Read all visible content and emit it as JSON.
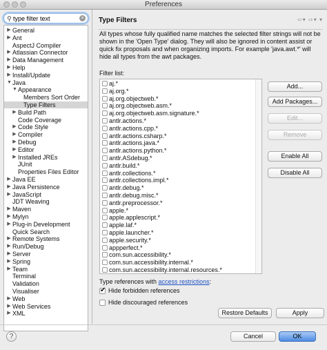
{
  "window": {
    "title": "Preferences"
  },
  "search": {
    "value": "type filter text"
  },
  "tree": [
    {
      "label": "General",
      "arrow": "▶",
      "level": 0
    },
    {
      "label": "Ant",
      "arrow": "▶",
      "level": 0
    },
    {
      "label": "AspectJ Compiler",
      "arrow": "",
      "level": 0
    },
    {
      "label": "Atlassian Connector",
      "arrow": "▶",
      "level": 0
    },
    {
      "label": "Data Management",
      "arrow": "▶",
      "level": 0
    },
    {
      "label": "Help",
      "arrow": "▶",
      "level": 0
    },
    {
      "label": "Install/Update",
      "arrow": "▶",
      "level": 0
    },
    {
      "label": "Java",
      "arrow": "▼",
      "level": 0
    },
    {
      "label": "Appearance",
      "arrow": "▼",
      "level": 1
    },
    {
      "label": "Members Sort Order",
      "arrow": "",
      "level": 2
    },
    {
      "label": "Type Filters",
      "arrow": "",
      "level": 2,
      "selected": true
    },
    {
      "label": "Build Path",
      "arrow": "▶",
      "level": 1
    },
    {
      "label": "Code Coverage",
      "arrow": "",
      "level": 1
    },
    {
      "label": "Code Style",
      "arrow": "▶",
      "level": 1
    },
    {
      "label": "Compiler",
      "arrow": "▶",
      "level": 1
    },
    {
      "label": "Debug",
      "arrow": "▶",
      "level": 1
    },
    {
      "label": "Editor",
      "arrow": "▶",
      "level": 1
    },
    {
      "label": "Installed JREs",
      "arrow": "▶",
      "level": 1
    },
    {
      "label": "JUnit",
      "arrow": "",
      "level": 1
    },
    {
      "label": "Properties Files Editor",
      "arrow": "",
      "level": 1
    },
    {
      "label": "Java EE",
      "arrow": "▶",
      "level": 0
    },
    {
      "label": "Java Persistence",
      "arrow": "▶",
      "level": 0
    },
    {
      "label": "JavaScript",
      "arrow": "▶",
      "level": 0
    },
    {
      "label": "JDT Weaving",
      "arrow": "",
      "level": 0
    },
    {
      "label": "Maven",
      "arrow": "▶",
      "level": 0
    },
    {
      "label": "Mylyn",
      "arrow": "▶",
      "level": 0
    },
    {
      "label": "Plug-in Development",
      "arrow": "▶",
      "level": 0
    },
    {
      "label": "Quick Search",
      "arrow": "",
      "level": 0
    },
    {
      "label": "Remote Systems",
      "arrow": "▶",
      "level": 0
    },
    {
      "label": "Run/Debug",
      "arrow": "▶",
      "level": 0
    },
    {
      "label": "Server",
      "arrow": "▶",
      "level": 0
    },
    {
      "label": "Spring",
      "arrow": "▶",
      "level": 0
    },
    {
      "label": "Team",
      "arrow": "▶",
      "level": 0
    },
    {
      "label": "Terminal",
      "arrow": "",
      "level": 0
    },
    {
      "label": "Validation",
      "arrow": "",
      "level": 0
    },
    {
      "label": "Visualiser",
      "arrow": "",
      "level": 0
    },
    {
      "label": "Web",
      "arrow": "▶",
      "level": 0
    },
    {
      "label": "Web Services",
      "arrow": "▶",
      "level": 0
    },
    {
      "label": "XML",
      "arrow": "▶",
      "level": 0
    }
  ],
  "page": {
    "title": "Type Filters",
    "description": "All types whose fully qualified name matches the selected filter strings will not be shown in the 'Open Type' dialog. They will also be ignored in content assist or quick fix proposals and when organizing imports. For example 'java.awt.*' will hide all types from the awt packages.",
    "filter_list_label": "Filter list:",
    "filters": [
      "aj.*",
      "aj.org.*",
      "aj.org.objectweb.*",
      "aj.org.objectweb.asm.*",
      "aj.org.objectweb.asm.signature.*",
      "antlr.actions.*",
      "antlr.actions.cpp.*",
      "antlr.actions.csharp.*",
      "antlr.actions.java.*",
      "antlr.actions.python.*",
      "antlr.ASdebug.*",
      "antlr.build.*",
      "antlr.collections.*",
      "antlr.collections.impl.*",
      "antlr.debug.*",
      "antlr.debug.misc.*",
      "antlr.preprocessor.*",
      "apple.*",
      "apple.applescript.*",
      "apple.laf.*",
      "apple.launcher.*",
      "apple.security.*",
      "appperfect.*",
      "com.sun.accessibility.*",
      "com.sun.accessibility.internal.*",
      "com.sun.accessibility.internal.resources.*"
    ],
    "buttons": {
      "add": "Add...",
      "add_packages": "Add Packages...",
      "edit": "Edit...",
      "remove": "Remove",
      "enable_all": "Enable All",
      "disable_all": "Disable All"
    },
    "type_refs_prefix": "Type references with ",
    "type_refs_link": "access restrictions",
    "type_refs_suffix": ":",
    "hide_forbidden": "Hide forbidden references",
    "hide_discouraged": "Hide discouraged references",
    "restore_defaults": "Restore Defaults",
    "apply": "Apply"
  },
  "footer": {
    "help": "?",
    "cancel": "Cancel",
    "ok": "OK"
  }
}
